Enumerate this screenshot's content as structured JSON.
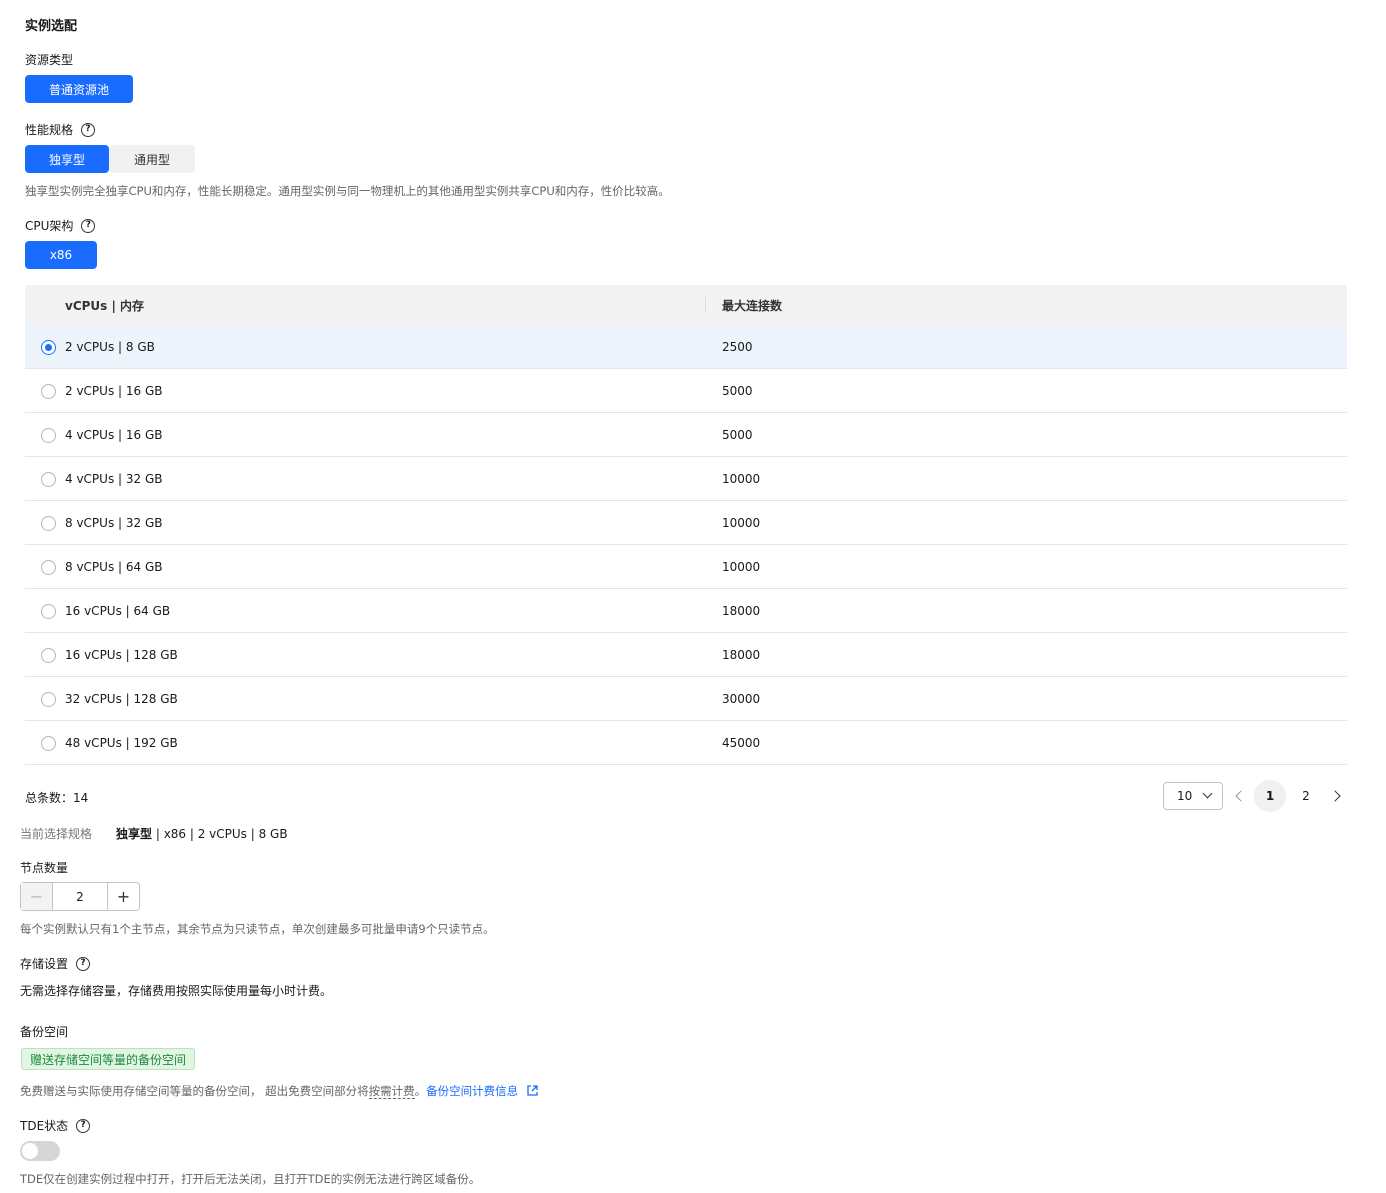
{
  "section_title": "实例选配",
  "resource_type": {
    "label": "资源类型",
    "option": "普通资源池"
  },
  "performance": {
    "label": "性能规格",
    "options": [
      "独享型",
      "通用型"
    ],
    "selected": "独享型",
    "description": "独享型实例完全独享CPU和内存，性能长期稳定。通用型实例与同一物理机上的其他通用型实例共享CPU和内存，性价比较高。"
  },
  "cpu_arch": {
    "label": "CPU架构",
    "option": "x86"
  },
  "table": {
    "headers": [
      "vCPUs | 内存",
      "最大连接数"
    ],
    "rows": [
      {
        "spec": "2 vCPUs | 8 GB",
        "conn": "2500",
        "selected": true
      },
      {
        "spec": "2 vCPUs | 16 GB",
        "conn": "5000"
      },
      {
        "spec": "4 vCPUs | 16 GB",
        "conn": "5000"
      },
      {
        "spec": "4 vCPUs | 32 GB",
        "conn": "10000"
      },
      {
        "spec": "8 vCPUs | 32 GB",
        "conn": "10000"
      },
      {
        "spec": "8 vCPUs | 64 GB",
        "conn": "10000"
      },
      {
        "spec": "16 vCPUs | 64 GB",
        "conn": "18000"
      },
      {
        "spec": "16 vCPUs | 128 GB",
        "conn": "18000"
      },
      {
        "spec": "32 vCPUs | 128 GB",
        "conn": "30000"
      },
      {
        "spec": "48 vCPUs | 192 GB",
        "conn": "45000"
      }
    ]
  },
  "pagination": {
    "total_label": "总条数：",
    "total": "14",
    "page_size": "10",
    "pages": [
      "1",
      "2"
    ],
    "current": "1"
  },
  "current_spec": {
    "label": "当前选择规格",
    "value_bold": "独享型",
    "value_rest": " | x86 | 2 vCPUs | 8 GB"
  },
  "nodes": {
    "label": "节点数量",
    "value": "2",
    "minus": "−",
    "plus": "+",
    "hint": "每个实例默认只有1个主节点，其余节点为只读节点，单次创建最多可批量申请9个只读节点。"
  },
  "storage": {
    "label": "存储设置",
    "text": "无需选择存储容量，存储费用按照实际使用量每小时计费。"
  },
  "backup": {
    "label": "备份空间",
    "badge": "赠送存储空间等量的备份空间",
    "text_prefix": "免费赠送与实际使用存储空间等量的备份空间， 超出免费空间部分将",
    "text_dashed": "按需计费",
    "text_suffix": "。",
    "link": "备份空间计费信息"
  },
  "tde": {
    "label": "TDE状态",
    "hint": "TDE仅在创建实例过程中打开，打开后无法关闭，且打开TDE的实例无法进行跨区域备份。"
  },
  "help_glyph": "?"
}
